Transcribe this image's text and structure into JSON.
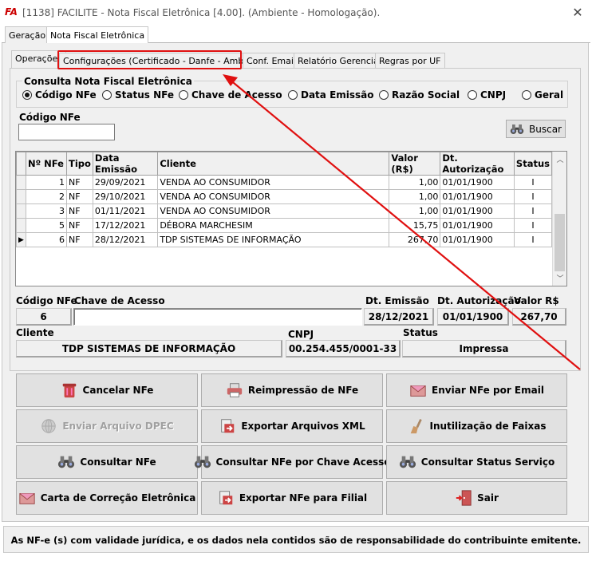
{
  "window": {
    "title": "[1138] FACILITE - Nota Fiscal Eletrônica [4.00]. (Ambiente - Homologação).",
    "logo": "FA"
  },
  "top_tabs": [
    "Geração",
    "Nota Fiscal Eletrônica"
  ],
  "sub_tabs": [
    "Operações",
    "Configurações (Certificado - Danfe - Ambiente)",
    "Conf. Email",
    "Relatório Gerencial",
    "Regras por UF"
  ],
  "consulta": {
    "title": "Consulta Nota Fiscal Eletrônica",
    "radios": [
      "Código NFe",
      "Status NFe",
      "Chave de Acesso",
      "Data Emissão",
      "Razão Social",
      "CNPJ",
      "Geral"
    ],
    "selected": "Código NFe",
    "codigo_label": "Código NFe",
    "codigo_value": "",
    "buscar": "Buscar"
  },
  "grid": {
    "headers": [
      "Nº NFe",
      "Tipo",
      "Data Emissão",
      "Cliente",
      "Valor (R$)",
      "Dt. Autorização",
      "Status"
    ],
    "rows": [
      [
        "1",
        "NF",
        "29/09/2021",
        "VENDA AO CONSUMIDOR",
        "1,00",
        "01/01/1900",
        "I"
      ],
      [
        "2",
        "NF",
        "29/10/2021",
        "VENDA AO CONSUMIDOR",
        "1,00",
        "01/01/1900",
        "I"
      ],
      [
        "3",
        "NF",
        "01/11/2021",
        "VENDA AO CONSUMIDOR",
        "1,00",
        "01/01/1900",
        "I"
      ],
      [
        "5",
        "NF",
        "17/12/2021",
        "DÉBORA MARCHESIM",
        "15,75",
        "01/01/1900",
        "I"
      ],
      [
        "6",
        "NF",
        "28/12/2021",
        "TDP SISTEMAS DE INFORMAÇÃO",
        "267,70",
        "01/01/1900",
        "I"
      ]
    ]
  },
  "detail": {
    "codigo_label": "Código NFe",
    "codigo": "6",
    "chave_label": "Chave de Acesso",
    "chave": "",
    "emissao_label": "Dt. Emissão",
    "emissao": "28/12/2021",
    "autorizacao_label": "Dt. Autorização",
    "autorizacao": "01/01/1900",
    "valor_label": "Valor R$",
    "valor": "267,70",
    "cliente_label": "Cliente",
    "cliente": "TDP SISTEMAS DE INFORMAÇÃO",
    "cnpj_label": "CNPJ",
    "cnpj": "00.254.455/0001-33",
    "status_label": "Status",
    "status": "Impressa"
  },
  "actions": [
    {
      "label": "Cancelar NFe",
      "icon": "trash-icon"
    },
    {
      "label": "Reimpressão de NFe",
      "icon": "printer-icon"
    },
    {
      "label": "Enviar NFe por Email",
      "icon": "envelope-icon"
    },
    {
      "label": "Enviar Arquivo DPEC",
      "icon": "globe-icon"
    },
    {
      "label": "Exportar Arquivos XML",
      "icon": "export-icon"
    },
    {
      "label": "Inutilização de Faixas",
      "icon": "broom-icon"
    },
    {
      "label": "Consultar NFe",
      "icon": "binoculars-icon"
    },
    {
      "label": "Consultar NFe por Chave Acesso",
      "icon": "binoculars-icon"
    },
    {
      "label": "Consultar Status Serviço",
      "icon": "binoculars-icon"
    },
    {
      "label": "Carta de Correção Eletrônica",
      "icon": "envelope-icon"
    },
    {
      "label": "Exportar NFe para Filial",
      "icon": "export-icon"
    },
    {
      "label": "Sair",
      "icon": "exit-door-icon"
    }
  ],
  "footer": "As NF-e (s) com validade jurídica, e os dados nela contidos são de responsabilidade do contribuinte emitente.",
  "colors": {
    "annotation": "#e01010",
    "background": "#f0f0f0",
    "button": "#e1e1e1"
  }
}
